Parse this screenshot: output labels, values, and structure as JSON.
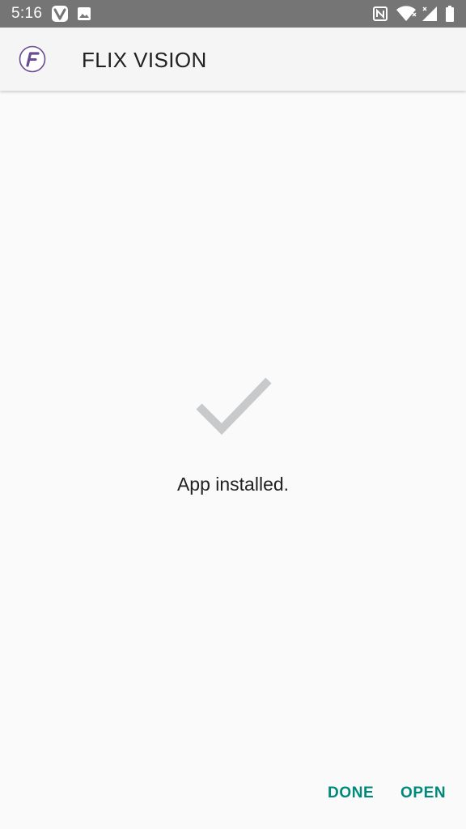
{
  "status_bar": {
    "time": "5:16",
    "icons": [
      "vivaldi-icon",
      "image-icon",
      "nfc-icon",
      "wifi-icon",
      "signal-icon",
      "battery-icon"
    ]
  },
  "app_bar": {
    "logo_letter": "F",
    "title": "FLIX VISION"
  },
  "content": {
    "message": "App installed."
  },
  "actions": {
    "done_label": "DONE",
    "open_label": "OPEN"
  },
  "colors": {
    "status_bar": "#757575",
    "app_bar": "#f5f5f5",
    "background": "#fafafa",
    "accent": "#00897b",
    "checkmark": "#c7c9cb",
    "logo": "#6a4c93"
  }
}
